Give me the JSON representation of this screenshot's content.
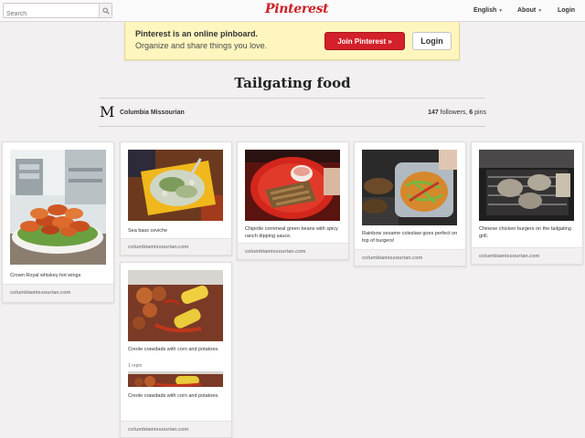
{
  "nav": {
    "search_placeholder": "Search",
    "logo": "Pinterest",
    "english": "English",
    "about": "About",
    "login": "Login"
  },
  "banner": {
    "title": "Pinterest is an online pinboard.",
    "subtitle": "Organize and share things you love.",
    "join": "Join Pinterest »",
    "login": "Login"
  },
  "board": {
    "title": "Tailgating food",
    "owner_initial": "M",
    "owner": "Columbia Missourian",
    "followers_count": "147",
    "followers_label": "followers,",
    "pins_count": "6",
    "pins_label": "pins"
  },
  "pins": [
    {
      "desc": "Crown Royal whiskey hot wings",
      "source": "columbiamissourian.com"
    },
    {
      "desc": "Sea bass ceviche",
      "source": "columbiamissourian.com"
    },
    {
      "desc": "Chipotle cornmeal green beans with spicy ranch dipping sauce.",
      "source": "columbiamissourian.com"
    },
    {
      "desc": "Rainbow sesame coleslaw goes perfect on top of burgers!",
      "source": "columbiamissourian.com"
    },
    {
      "desc": "Chinese chicken burgers on the tailgating grill.",
      "source": "columbiamissourian.com"
    },
    {
      "desc": "Creole crawdads with corn and potatoes.",
      "repins": "1 repin",
      "desc2": "Creole crawdads with corn and potatoes.",
      "source": "columbiamissourian.com"
    }
  ],
  "colors": {
    "brand_red": "#cb2027",
    "banner_yellow": "#fff6bf",
    "background": "#f2f0f0"
  }
}
